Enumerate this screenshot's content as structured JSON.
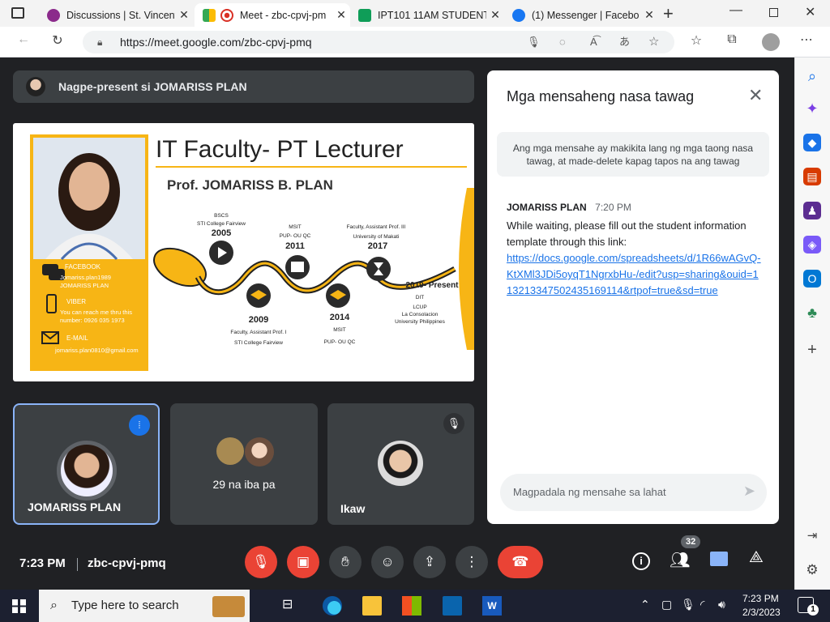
{
  "browser": {
    "tabs": [
      {
        "title": "Discussions | St. Vincent",
        "icon": "seal-icon"
      },
      {
        "title": "Meet - zbc-cpvj-pm",
        "icon": "meet-icon"
      },
      {
        "title": "IPT101 11AM STUDENT",
        "icon": "sheets-icon"
      },
      {
        "title": "(1) Messenger | Facebo",
        "icon": "facebook-icon"
      }
    ],
    "url": "https://meet.google.com/zbc-cpvj-pmq"
  },
  "presenting_banner": "Nagpe-present si JOMARISS PLAN",
  "slide": {
    "title": "IT Faculty- PT Lecturer",
    "name": "Prof. JOMARISS B. PLAN",
    "contacts": [
      {
        "label": "FACEBOOK",
        "line1": "Jomariss.plan1989",
        "line2": "JOMARISS PLAN"
      },
      {
        "label": "VIBER",
        "line1": "You can reach me thru this",
        "line2": "number: 0926 035 1973"
      },
      {
        "label": "E-MAIL",
        "line1": "jomariss.plan0810@gmail.com",
        "line2": ""
      }
    ],
    "timeline": [
      {
        "year": "2005",
        "top1": "BSCS",
        "top2": "STI College Fairview",
        "bottom1": "",
        "bottom2": ""
      },
      {
        "year": "2009",
        "top1": "",
        "top2": "",
        "bottom1": "Faculty, Assistant Prof. I",
        "bottom2": "STI College Fairview"
      },
      {
        "year": "2011",
        "top1": "MSIT",
        "top2": "PUP- OU QC",
        "bottom1": "",
        "bottom2": ""
      },
      {
        "year": "2014",
        "top1": "",
        "top2": "",
        "bottom1": "MSIT",
        "bottom2": "PUP- OU QC"
      },
      {
        "year": "2017",
        "top1": "Faculty, Assistant Prof. III",
        "top2": "University of Makati",
        "bottom1": "",
        "bottom2": ""
      },
      {
        "year": "2019- Present",
        "top1": "",
        "top2": "",
        "bottom1": "DIT",
        "bottom2": "LCUP",
        "bottom3": "La Consolacion",
        "bottom4": "University Philippines"
      }
    ]
  },
  "participants": [
    {
      "name": "JOMARISS PLAN",
      "speaking": true
    },
    {
      "name": "29 na iba pa"
    },
    {
      "name": "Ikaw",
      "muted": true
    }
  ],
  "chat": {
    "title": "Mga mensaheng nasa tawag",
    "notice": "Ang mga mensahe ay makikita lang ng mga taong nasa tawag, at made-delete kapag tapos na ang tawag",
    "messages": [
      {
        "sender": "JOMARISS PLAN",
        "time": "7:20 PM",
        "text": "While waiting, please fill out the student information template through this link:",
        "link": "https://docs.google.com/spreadsheets/d/1R66wAGvQ-KtXMl3JDi5oyqT1NgrxbHu-/edit?usp=sharing&ouid=113213347502435169114&rtpof=true&sd=true"
      }
    ],
    "input_placeholder": "Magpadala ng mensahe sa lahat"
  },
  "controls": {
    "time": "7:23 PM",
    "meeting_code": "zbc-cpvj-pmq",
    "participant_count": "32"
  },
  "taskbar": {
    "search_placeholder": "Type here to search",
    "time": "7:23 PM",
    "date": "2/3/2023",
    "notification_count": "1"
  },
  "colors": {
    "accent_yellow": "#f7b515",
    "meet_bg": "#202124",
    "blue": "#8ab4f8",
    "red": "#ea4335",
    "link": "#1a73e8"
  }
}
